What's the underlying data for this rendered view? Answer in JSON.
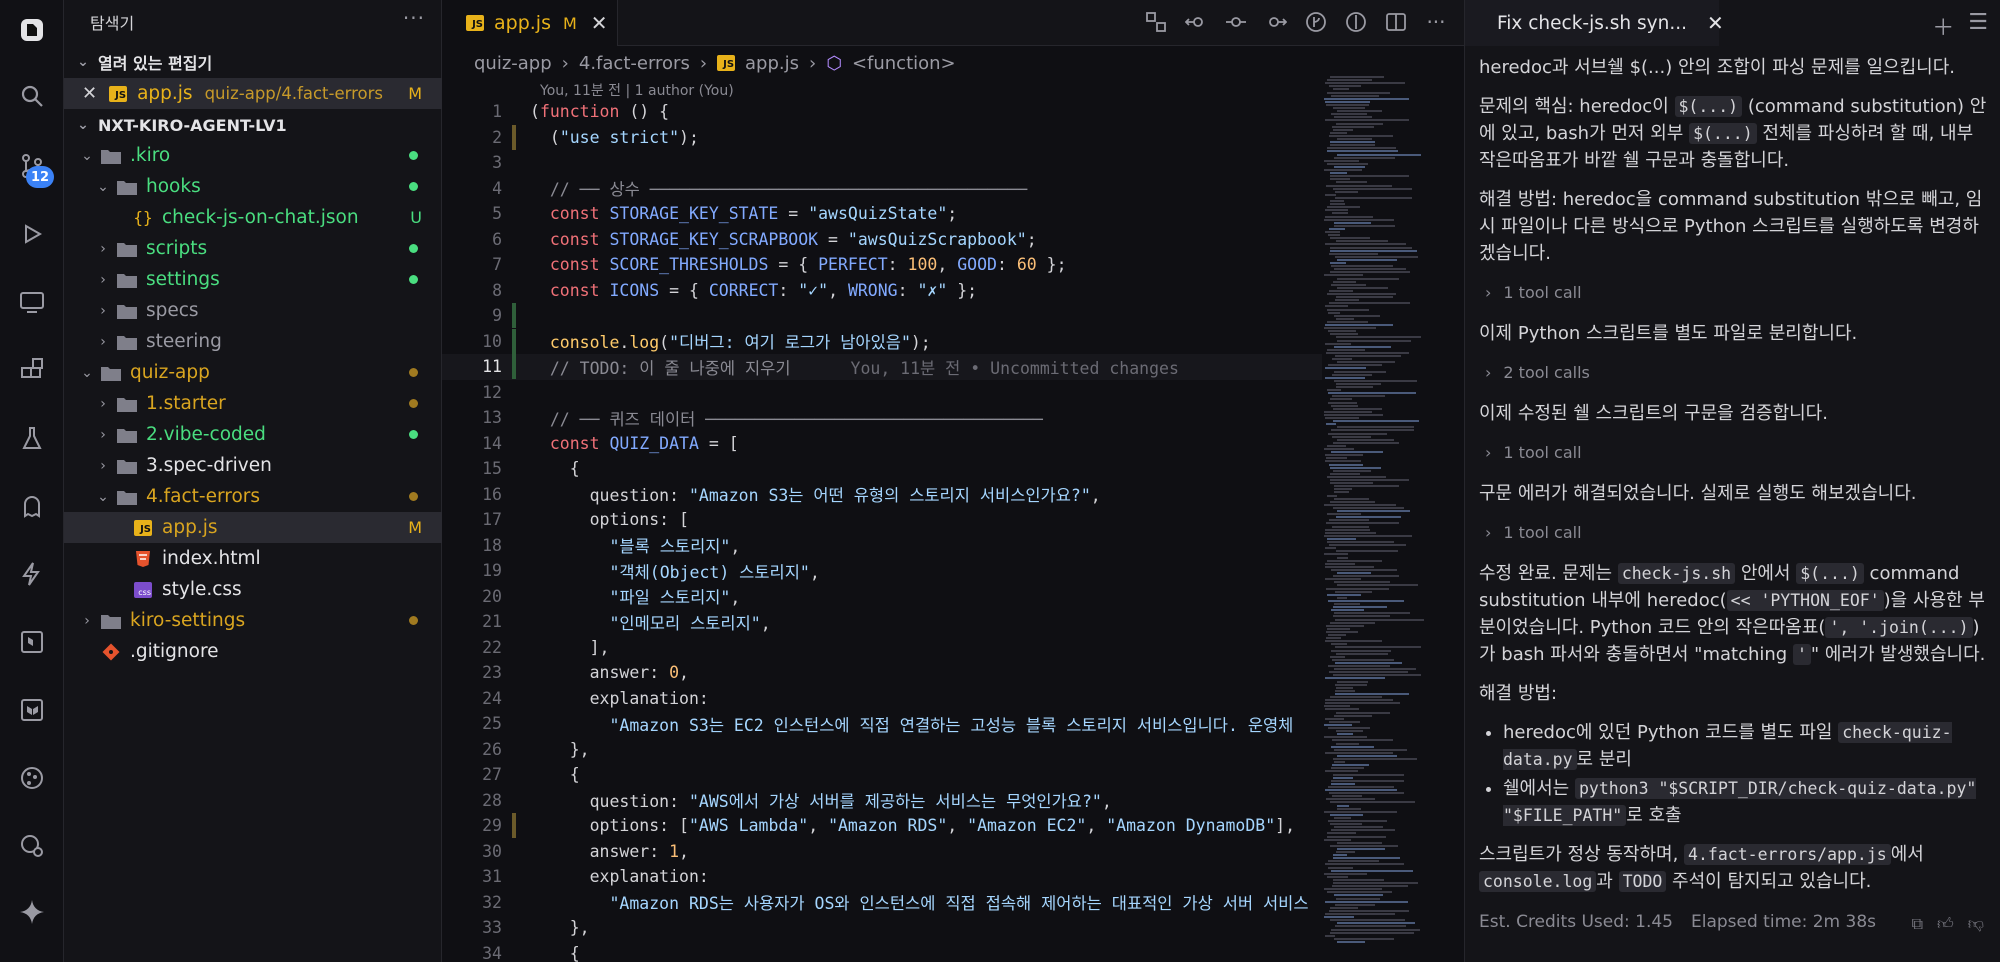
{
  "activity": {
    "scm_badge": "12"
  },
  "sidebar": {
    "title": "탐색기",
    "open_editors_title": "열려 있는 편집기",
    "open_editor": {
      "name": "app.js",
      "path": "quiz-app/4.fact-errors",
      "status": "M"
    },
    "project_title": "NXT-KIRO-AGENT-LV1",
    "items": [
      {
        "label": ".kiro",
        "type": "folder",
        "open": true,
        "depth": 1,
        "color": "#4ade80",
        "dot": "#4ade80",
        "status": ""
      },
      {
        "label": "hooks",
        "type": "folder",
        "open": true,
        "depth": 2,
        "color": "#4ade80",
        "dot": "#4ade80",
        "status": ""
      },
      {
        "label": "check-js-on-chat.json",
        "type": "json",
        "open": false,
        "depth": 3,
        "color": "#4ade80",
        "dot": "",
        "status": "U"
      },
      {
        "label": "scripts",
        "type": "folder",
        "open": false,
        "depth": 2,
        "color": "#4ade80",
        "dot": "#4ade80",
        "status": ""
      },
      {
        "label": "settings",
        "type": "folder",
        "open": false,
        "depth": 2,
        "color": "#4ade80",
        "dot": "#4ade80",
        "status": ""
      },
      {
        "label": "specs",
        "type": "folder",
        "open": false,
        "depth": 2,
        "color": "#9a9aa3",
        "dot": "",
        "status": ""
      },
      {
        "label": "steering",
        "type": "folder",
        "open": false,
        "depth": 2,
        "color": "#9a9aa3",
        "dot": "",
        "status": ""
      },
      {
        "label": "quiz-app",
        "type": "folder",
        "open": true,
        "depth": 1,
        "color": "#d9a520",
        "dot": "#a07a20",
        "status": ""
      },
      {
        "label": "1.starter",
        "type": "folder",
        "open": false,
        "depth": 2,
        "color": "#d9a520",
        "dot": "#a07a20",
        "status": ""
      },
      {
        "label": "2.vibe-coded",
        "type": "folder",
        "open": false,
        "depth": 2,
        "color": "#4ade80",
        "dot": "#4ade80",
        "status": ""
      },
      {
        "label": "3.spec-driven",
        "type": "folder",
        "open": false,
        "depth": 2,
        "color": "#e4e4e7",
        "dot": "",
        "status": ""
      },
      {
        "label": "4.fact-errors",
        "type": "folder",
        "open": true,
        "depth": 2,
        "color": "#d9a520",
        "dot": "#a07a20",
        "status": ""
      },
      {
        "label": "app.js",
        "type": "js",
        "open": false,
        "depth": 3,
        "color": "#d9a520",
        "dot": "",
        "status": "M"
      },
      {
        "label": "index.html",
        "type": "html",
        "open": false,
        "depth": 3,
        "color": "#e4e4e7",
        "dot": "",
        "status": ""
      },
      {
        "label": "style.css",
        "type": "css",
        "open": false,
        "depth": 3,
        "color": "#e4e4e7",
        "dot": "",
        "status": ""
      },
      {
        "label": "kiro-settings",
        "type": "folder",
        "open": false,
        "depth": 1,
        "color": "#d9a520",
        "dot": "#a07a20",
        "status": ""
      },
      {
        "label": ".gitignore",
        "type": "git",
        "open": false,
        "depth": 1,
        "color": "#e4e4e7",
        "dot": "",
        "status": ""
      }
    ]
  },
  "editor": {
    "tab": {
      "label": "app.js",
      "status": "M"
    },
    "breadcrumb": [
      "quiz-app",
      "4.fact-errors",
      "app.js",
      "<function>"
    ],
    "blame": "You, 11분 전 | 1 author (You)",
    "inline_blame": "You, 11분 전 • Uncommitted changes",
    "lines": [
      "(function () {",
      "  (\"use strict\");",
      "",
      "  // ── 상수 ──────────────────────────────────────",
      "  const STORAGE_KEY_STATE = \"awsQuizState\";",
      "  const STORAGE_KEY_SCRAPBOOK = \"awsQuizScrapbook\";",
      "  const SCORE_THRESHOLDS = { PERFECT: 100, GOOD: 60 };",
      "  const ICONS = { CORRECT: \"✓\", WRONG: \"✗\" };",
      "",
      "  console.log(\"디버그: 여기 로그가 남아있음\");",
      "  // TODO: 이 줄 나중에 지우기",
      "",
      "  // ── 퀴즈 데이터 ──────────────────────────────────",
      "  const QUIZ_DATA = [",
      "    {",
      "      question: \"Amazon S3는 어떤 유형의 스토리지 서비스인가요?\",",
      "      options: [",
      "        \"블록 스토리지\",",
      "        \"객체(Object) 스토리지\",",
      "        \"파일 스토리지\",",
      "        \"인메모리 스토리지\",",
      "      ],",
      "      answer: 0,",
      "      explanation:",
      "        \"Amazon S3는 EC2 인스턴스에 직접 연결하는 고성능 블록 스토리지 서비스입니다. 운영체",
      "    },",
      "    {",
      "      question: \"AWS에서 가상 서버를 제공하는 서비스는 무엇인가요?\",",
      "      options: [\"AWS Lambda\", \"Amazon RDS\", \"Amazon EC2\", \"Amazon DynamoDB\"],",
      "      answer: 1,",
      "      explanation:",
      "        \"Amazon RDS는 사용자가 OS와 인스턴스에 직접 접속해 제어하는 대표적인 가상 서버 서비스",
      "    },",
      "    {"
    ],
    "line_numbers": [
      "1",
      "2",
      "3",
      "4",
      "5",
      "6",
      "7",
      "8",
      "9",
      "10",
      "11",
      "12",
      "13",
      "14",
      "15",
      "16",
      "17",
      "18",
      "19",
      "20",
      "21",
      "22",
      "23",
      "24",
      "25",
      "26",
      "27",
      "28",
      "29",
      "30",
      "31",
      "32",
      "33",
      "34"
    ],
    "active_line": 11
  },
  "chat": {
    "tab_title": "Fix check-js.sh syn...",
    "p0": "heredoc과 서브쉘 $(...) 안의 조합이 파싱 문제를 일으킵니다.",
    "p1a": "문제의 핵심: heredoc이 ",
    "p1b": "$(...)",
    "p1c": " (command substitution) 안에 있고, bash가 먼저 외부 ",
    "p1d": "$(...)",
    "p1e": " 전체를 파싱하려 할 때, 내부 작은따옴표가 바깥 쉘 구문과 충돌합니다.",
    "p2": "해결 방법: heredoc을 command substitution 밖으로 빼고, 임시 파일이나 다른 방식으로 Python 스크립트를 실행하도록 변경하겠습니다.",
    "tc1": "1 tool call",
    "p3": "이제 Python 스크립트를 별도 파일로 분리합니다.",
    "tc2": "2 tool calls",
    "p4": "이제 수정된 쉘 스크립트의 구문을 검증합니다.",
    "tc3": "1 tool call",
    "p5": "구문 에러가 해결되었습니다. 실제로 실행도 해보겠습니다.",
    "tc4": "1 tool call",
    "p6a": "수정 완료. 문제는 ",
    "p6b": "check-js.sh",
    "p6c": " 안에서 ",
    "p6d": "$(...)",
    "p6e": " command substitution 내부에 heredoc(",
    "p6f": "<< 'PYTHON_EOF'",
    "p6g": ")을 사용한 부분이었습니다. Python 코드 안의 작은따옴표(",
    "p6h": "', '.join(...)",
    "p6i": ")가 bash 파서와 충돌하면서 \"matching ",
    "p6j": "'",
    "p6k": "\" 에러가 발생했습니다.",
    "p7": "해결 방법:",
    "li1a": "heredoc에 있던 Python 코드를 별도 파일 ",
    "li1b": "check-quiz-data.py",
    "li1c": "로 분리",
    "li2a": "쉘에서는 ",
    "li2b": "python3 \"$SCRIPT_DIR/check-quiz-data.py\" \"$FILE_PATH\"",
    "li2c": "로 호출",
    "p8a": "스크립트가 정상 동작하며, ",
    "p8b": "4.fact-errors/app.js",
    "p8c": "에서 ",
    "p8d": "console.log",
    "p8e": "과 ",
    "p8f": "TODO",
    "p8g": " 주석이 탐지되고 있습니다.",
    "credits": "Est. Credits Used: 1.45",
    "elapsed": "Elapsed time: 2m 38s"
  }
}
